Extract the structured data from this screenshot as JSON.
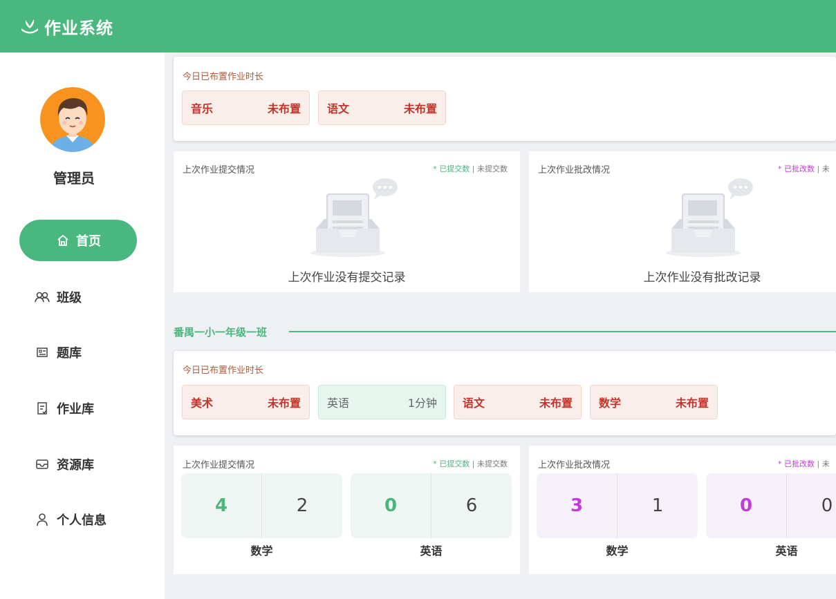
{
  "header": {
    "app_title": "作业系统",
    "logo_icon": "book-leaf-icon"
  },
  "sidebar": {
    "user_name": "管理员",
    "items": [
      {
        "label": "首页",
        "icon": "home-icon",
        "active": true
      },
      {
        "label": "班级",
        "icon": "users-icon",
        "active": false
      },
      {
        "label": "题库",
        "icon": "question-bank-icon",
        "active": false
      },
      {
        "label": "作业库",
        "icon": "homework-icon",
        "active": false
      },
      {
        "label": "资源库",
        "icon": "inbox-icon",
        "active": false
      },
      {
        "label": "个人信息",
        "icon": "user-icon",
        "active": false
      }
    ]
  },
  "top_section": {
    "today_card": {
      "title": "今日已布置作业时长",
      "subjects": [
        {
          "name": "音乐",
          "status": "未布置"
        },
        {
          "name": "语文",
          "status": "未布置"
        }
      ]
    },
    "submit_card": {
      "title": "上次作业提交情况",
      "legend_dot": "*",
      "legend_done": "已提交数",
      "legend_sep": "|",
      "legend_not": "未提交数",
      "empty_text": "上次作业没有提交记录"
    },
    "grade_card": {
      "title": "上次作业批改情况",
      "legend_dot": "*",
      "legend_done": "已批改数",
      "legend_sep": "|",
      "legend_not": "未",
      "empty_text": "上次作业没有批改记录"
    }
  },
  "class_section": {
    "title": "番禺一小一年级一班",
    "today_card": {
      "title": "今日已布置作业时长",
      "subjects": [
        {
          "name": "美术",
          "status": "未布置"
        },
        {
          "name": "英语",
          "status": "1分钟"
        },
        {
          "name": "语文",
          "status": "未布置"
        },
        {
          "name": "数学",
          "status": "未布置"
        }
      ]
    },
    "submit_card": {
      "title": "上次作业提交情况",
      "legend_dot": "*",
      "legend_done": "已提交数",
      "legend_sep": "|",
      "legend_not": "未提交数",
      "stats": [
        {
          "subject": "数学",
          "done": "4",
          "not_done": "2"
        },
        {
          "subject": "英语",
          "done": "0",
          "not_done": "6"
        }
      ]
    },
    "grade_card": {
      "title": "上次作业批改情况",
      "legend_dot": "*",
      "legend_done": "已批改数",
      "legend_sep": "|",
      "legend_not": "未",
      "stats": [
        {
          "subject": "数学",
          "done": "3",
          "not_done": "1"
        },
        {
          "subject": "英语",
          "done": "0",
          "not_done": "0"
        }
      ]
    }
  }
}
